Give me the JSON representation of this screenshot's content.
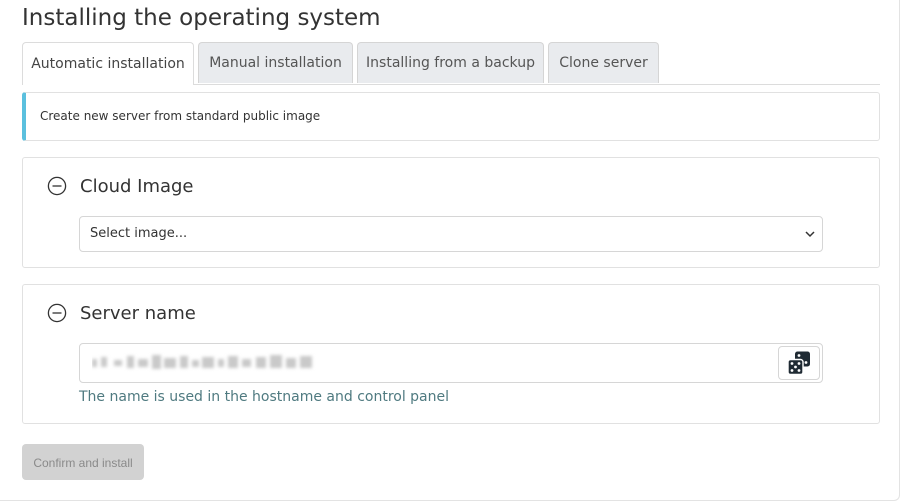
{
  "page": {
    "title": "Installing the operating system"
  },
  "tabs": [
    {
      "label": "Automatic installation",
      "active": true
    },
    {
      "label": "Manual installation",
      "active": false
    },
    {
      "label": "Installing from a backup",
      "active": false
    },
    {
      "label": "Clone server",
      "active": false
    }
  ],
  "notice": {
    "text": "Create new server from standard public image",
    "accent_color": "#5bc0de"
  },
  "cloud_image": {
    "title": "Cloud Image",
    "collapse_icon": "minus-circle-icon",
    "select": {
      "value": "Select image...",
      "icon": "chevron-down-icon"
    }
  },
  "server_name": {
    "title": "Server name",
    "collapse_icon": "minus-circle-icon",
    "generate_icon": "dice-icon",
    "help_text": "The name is used in the hostname and control panel",
    "help_color": "#4f7a80"
  },
  "actions": {
    "confirm_label": "Confirm and install",
    "confirm_disabled": true
  }
}
